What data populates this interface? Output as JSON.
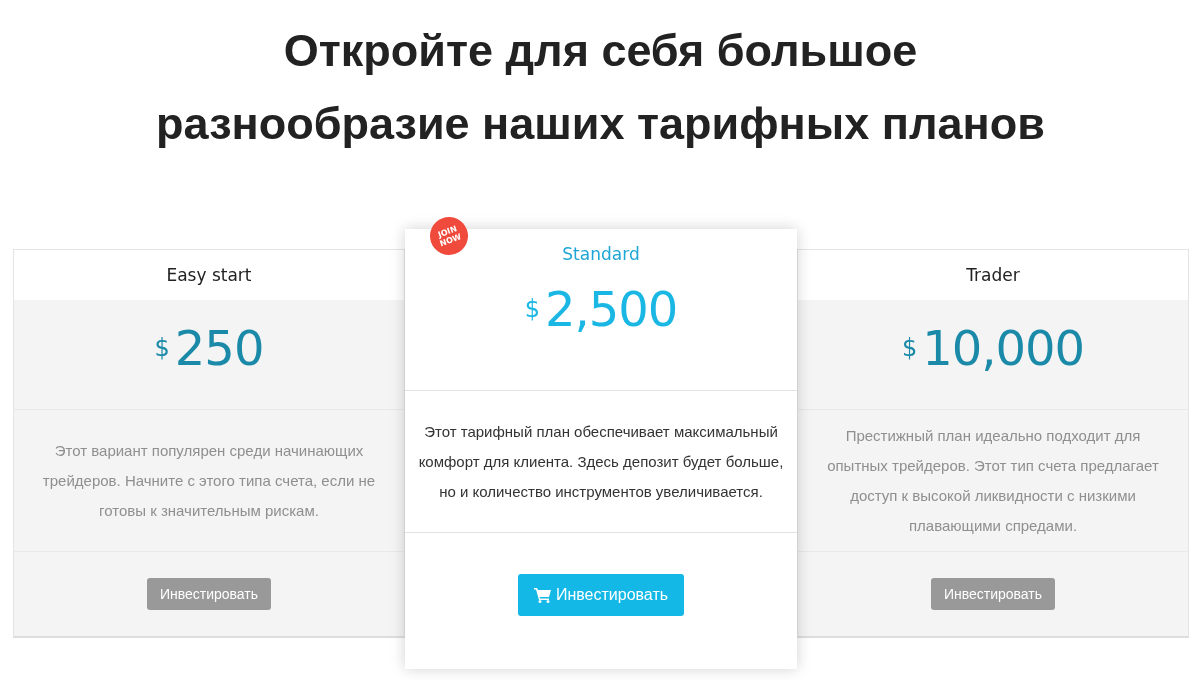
{
  "heading": "Откройте для себя большое разнообразие наших тарифных планов",
  "plans": [
    {
      "name": "Easy start",
      "featured": false,
      "currency": "$",
      "price": "250",
      "description": "Этот вариант популярен среди начинающих трейдеров. Начните с этого типа счета, если не готовы к значительным рискам.",
      "button": "Инвестировать"
    },
    {
      "name": "Standard",
      "featured": true,
      "badge": "JOIN NOW",
      "currency": "$",
      "price": "2,500",
      "description": "Этот тарифный план обеспечивает максимальный комфорт для клиента. Здесь депозит будет больше, но и количество инструментов увеличивается.",
      "button": "Инвестировать"
    },
    {
      "name": "Trader",
      "featured": false,
      "currency": "$",
      "price": "10,000",
      "description": "Престижный план идеально подходит для опытных трейдеров. Этот тип счета предлагает доступ к высокой ликвидности с низкими плавающими спредами.",
      "button": "Инвестировать"
    }
  ]
}
